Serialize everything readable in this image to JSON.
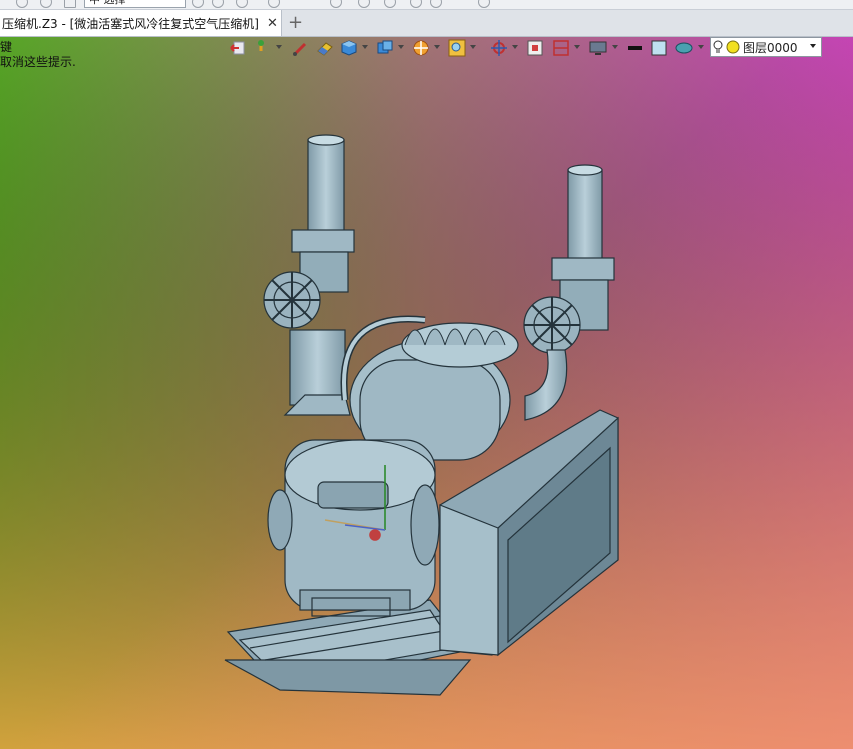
{
  "window": {
    "tab_title": "压缩机.Z3 - [微油活塞式风冷往复式空气压缩机]",
    "tab_close": "✕",
    "tab_new": "+",
    "top_filter_value": "中  选择"
  },
  "hint": {
    "line1": "键",
    "line2": "取消这些提示."
  },
  "toolbar": {
    "layer_name": "图层0000"
  },
  "colors": {
    "model": "#9fb8c4",
    "model_dark": "#6b8794",
    "model_edge": "#2b3a42",
    "bg_top_left": "#5aad2a",
    "bg_top_right": "#cc44bb",
    "bg_bottom_left": "#d6b020",
    "bg_bottom_right": "#ee8a7a"
  }
}
